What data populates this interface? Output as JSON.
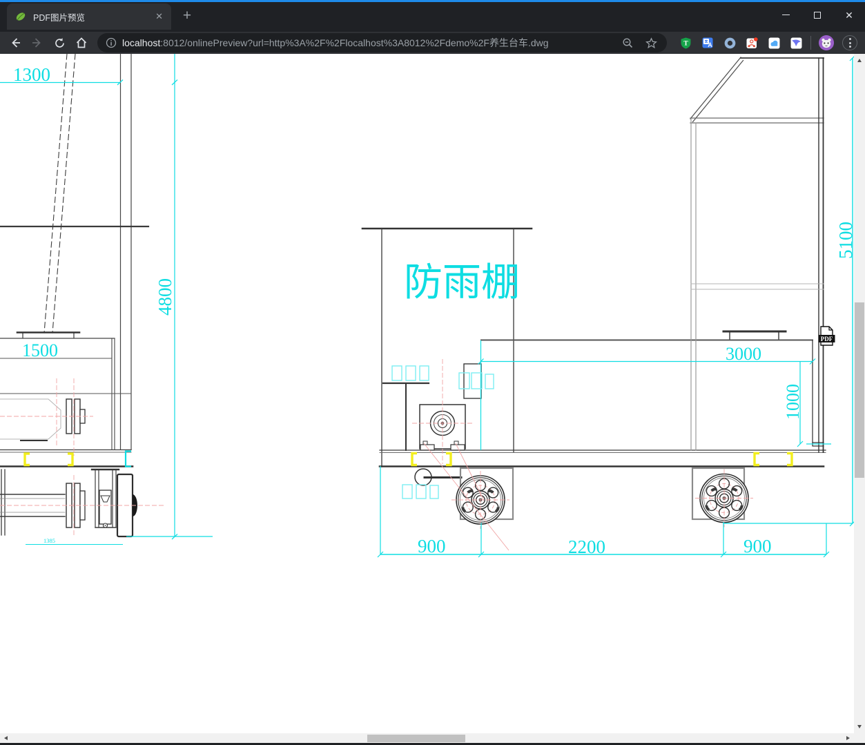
{
  "browser": {
    "accent_color": "#1e8bea",
    "tab": {
      "title": "PDF图片预览"
    },
    "new_tab_label": "+",
    "window_controls": {
      "minimize": "minimize",
      "maximize": "maximize",
      "close": "✕"
    },
    "address": {
      "host": "localhost",
      "rest": ":8012/onlinePreview?url=http%3A%2F%2Flocalhost%3A8012%2Fdemo%2F",
      "file_cjk": "养生台车",
      "file_ext": ".dwg",
      "full_url": "localhost:8012/onlinePreview?url=http%3A%2F%2Flocalhost%3A8012%2Fdemo%2F养生台车.dwg"
    }
  },
  "drawing": {
    "shed_label": "防雨棚",
    "pdf_badge": "PDF",
    "dims": {
      "left_width": "1300",
      "left_height": "4800",
      "left_inner": "1500",
      "left_small": "1385",
      "right_height": "5100",
      "box_width": "3000",
      "box_height": "1000",
      "wheel_left": "900",
      "wheel_span": "2200",
      "wheel_right": "900"
    },
    "colors": {
      "dimension": "#0edde2",
      "highlight": "#f2ee1e",
      "centerline": "#f0a5a5",
      "line": "#3c3e40"
    }
  }
}
